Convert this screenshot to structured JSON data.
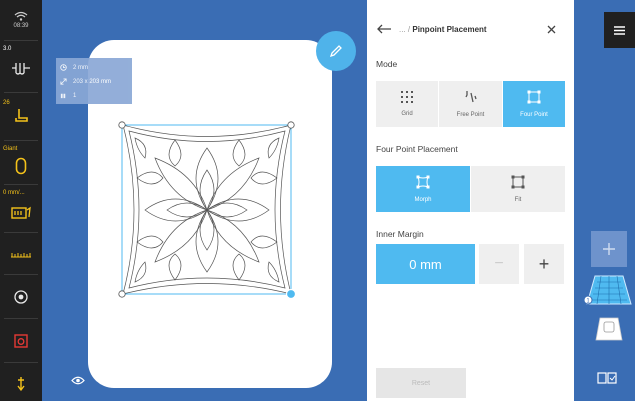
{
  "status": {
    "time": "08:39",
    "wifi_icon": "wifi-icon"
  },
  "rail": [
    {
      "value": "3.0",
      "icon": "stitch-length-icon"
    },
    {
      "value": "26",
      "icon": "presser-foot-icon"
    },
    {
      "value": "Giant",
      "icon": "hoop-icon"
    },
    {
      "value": "0 mm/...",
      "icon": "speed-icon"
    },
    {
      "value": "",
      "icon": "ruler-icon"
    },
    {
      "value": "",
      "icon": "needle-position-icon"
    },
    {
      "value": "",
      "icon": "camera-icon"
    },
    {
      "value": "",
      "icon": "needle-down-icon"
    }
  ],
  "design_info": {
    "size_1": "2 mm",
    "size_2": "203 x 203 mm",
    "count": "1"
  },
  "panel": {
    "breadcrumb": "... /",
    "title": "Pinpoint Placement",
    "mode_label": "Mode",
    "modes": [
      {
        "label": "Grid",
        "active": false
      },
      {
        "label": "Free Point",
        "active": false
      },
      {
        "label": "Four Point",
        "active": true
      }
    ],
    "four_point_label": "Four Point Placement",
    "four_point_options": [
      {
        "label": "Morph",
        "active": true
      },
      {
        "label": "Fit",
        "active": false
      }
    ],
    "inner_margin_label": "Inner Margin",
    "inner_margin_value": "0 mm",
    "minus": "−",
    "plus": "+",
    "reset": "Reset"
  },
  "colors": {
    "accent": "#4fbaf0",
    "canvas": "#3a6db4",
    "rail": "#202020"
  }
}
